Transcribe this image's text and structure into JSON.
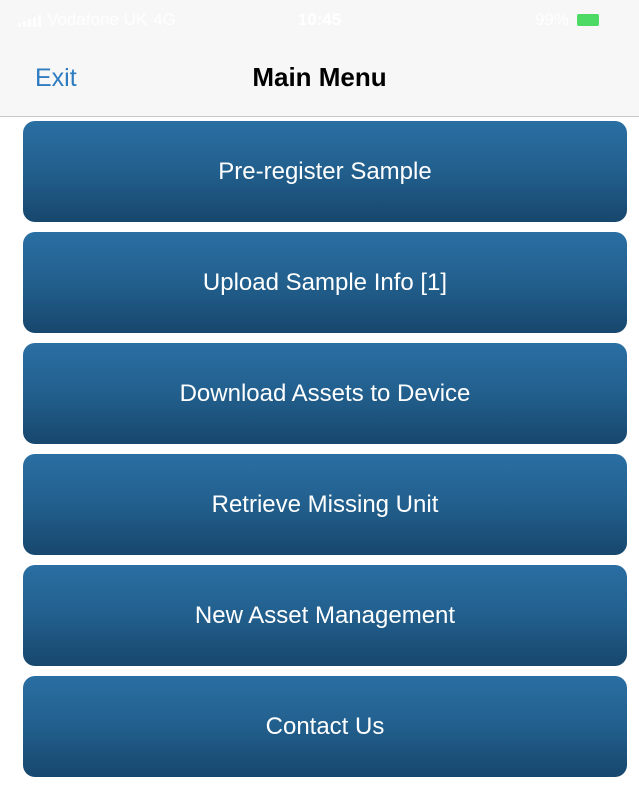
{
  "status_bar": {
    "carrier": "Vodafone UK",
    "network": "4G",
    "time": "10:45",
    "battery_percent": "99%",
    "battery_color": "#4cd964"
  },
  "nav": {
    "exit_label": "Exit",
    "title": "Main Menu",
    "exit_color": "#2f7cc0"
  },
  "menu": {
    "items": [
      {
        "label": "Pre-register Sample"
      },
      {
        "label": "Upload Sample Info [1]"
      },
      {
        "label": "Download Assets to Device"
      },
      {
        "label": "Retrieve Missing Unit"
      },
      {
        "label": "New Asset Management"
      },
      {
        "label": "Contact Us"
      }
    ],
    "button_color": "#225f8d"
  }
}
